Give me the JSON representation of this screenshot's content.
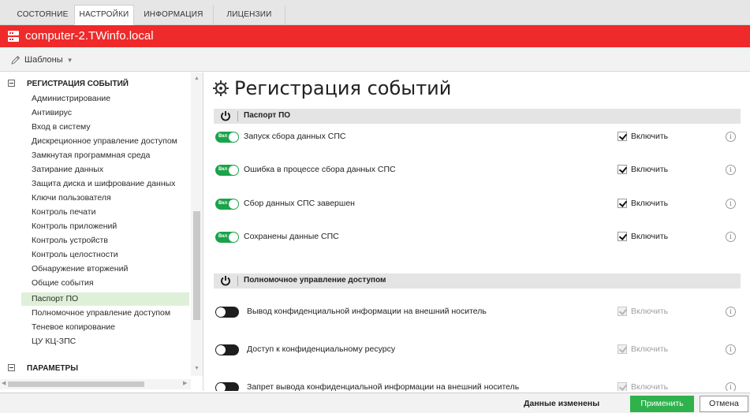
{
  "tabs": [
    {
      "label": "СОСТОЯНИЕ"
    },
    {
      "label": "НАСТРОЙКИ"
    },
    {
      "label": "ИНФОРМАЦИЯ"
    },
    {
      "label": "ЛИЦЕНЗИИ"
    }
  ],
  "active_tab": "НАСТРОЙКИ",
  "host": {
    "name": "computer-2.TWinfo.local",
    "icon": "server-icon"
  },
  "toolbar": {
    "templates_label": "Шаблоны",
    "templates_icon": "pencil-icon"
  },
  "tree": {
    "group1": "РЕГИСТРАЦИЯ СОБЫТИЙ",
    "items": [
      "Администрирование",
      "Антивирус",
      "Вход в систему",
      "Дискреционное управление доступом",
      "Замкнутая программная среда",
      "Затирание данных",
      "Защита диска и шифрование данных",
      "Ключи пользователя",
      "Контроль печати",
      "Контроль приложений",
      "Контроль устройств",
      "Контроль целостности",
      "Обнаружение вторжений",
      "Общие события",
      "Паспорт ПО",
      "Полномочное управление доступом",
      "Теневое копирование",
      "ЦУ КЦ-ЗПС"
    ],
    "selected": "Паспорт ПО",
    "group2": "ПАРАМЕТРЫ"
  },
  "main": {
    "title": "Регистрация событий",
    "sections": [
      {
        "title": "Паспорт ПО",
        "rows": [
          {
            "toggle": "Вкл",
            "label": "Запуск сбора данных СПС",
            "check_label": "Включить",
            "checked": true,
            "disabled": false
          },
          {
            "toggle": "Вкл",
            "label": "Ошибка в процессе сбора данных СПС",
            "check_label": "Включить",
            "checked": true,
            "disabled": false
          },
          {
            "toggle": "Вкл",
            "label": "Сбор данных СПС завершен",
            "check_label": "Включить",
            "checked": true,
            "disabled": false
          },
          {
            "toggle": "Вкл",
            "label": "Сохранены данные СПС",
            "check_label": "Включить",
            "checked": true,
            "disabled": false
          }
        ]
      },
      {
        "title": "Полномочное управление доступом",
        "rows": [
          {
            "toggle": "",
            "label": "Вывод конфиденциальной информации на внешний носитель",
            "check_label": "Включить",
            "checked": true,
            "disabled": true
          },
          {
            "toggle": "",
            "label": "Доступ к конфиденциальному ресурсу",
            "check_label": "Включить",
            "checked": true,
            "disabled": true
          },
          {
            "toggle": "",
            "label": "Запрет вывода конфиденциальной информации на внешний носитель",
            "check_label": "Включить",
            "checked": true,
            "disabled": true
          }
        ]
      }
    ],
    "info_glyph": "i"
  },
  "status": {
    "text": "Данные изменены",
    "apply": "Применить",
    "cancel": "Отмена"
  },
  "colors": {
    "accent_red": "#ee2a2a",
    "toggle_green": "#1aa34a",
    "apply_green": "#2fb14c",
    "selected_bg": "#dff0d8"
  }
}
